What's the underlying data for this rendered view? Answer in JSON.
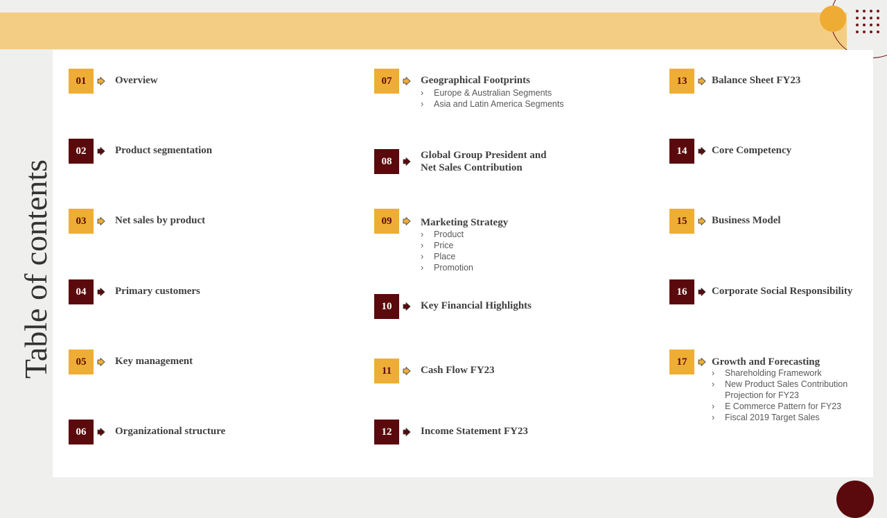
{
  "page": {
    "title": "Table of contents"
  },
  "colors": {
    "gold": "#eeae36",
    "maroon": "#5a0a0c",
    "band": "#f4cd85"
  },
  "items": [
    {
      "number": "01",
      "title": "Overview",
      "style": "gold",
      "subitems": []
    },
    {
      "number": "02",
      "title": "Product segmentation",
      "style": "maroon",
      "subitems": []
    },
    {
      "number": "03",
      "title": "Net sales by product",
      "style": "gold",
      "subitems": []
    },
    {
      "number": "04",
      "title": "Primary customers",
      "style": "maroon",
      "subitems": []
    },
    {
      "number": "05",
      "title": "Key management",
      "style": "gold",
      "subitems": []
    },
    {
      "number": "06",
      "title": "Organizational structure",
      "style": "maroon",
      "subitems": []
    },
    {
      "number": "07",
      "title": "Geographical Footprints",
      "style": "gold",
      "subitems": [
        "Europe & Australian Segments",
        "Asia and Latin America Segments"
      ]
    },
    {
      "number": "08",
      "title_lines": [
        "Global Group President and",
        "Net Sales Contribution"
      ],
      "style": "maroon",
      "subitems": []
    },
    {
      "number": "09",
      "title": "Marketing Strategy",
      "style": "gold",
      "subitems": [
        "Product",
        "Price",
        "Place",
        "Promotion"
      ]
    },
    {
      "number": "10",
      "title": "Key Financial Highlights",
      "style": "maroon",
      "subitems": []
    },
    {
      "number": "11",
      "title": "Cash Flow FY23",
      "style": "gold",
      "subitems": []
    },
    {
      "number": "12",
      "title": "Income Statement FY23",
      "style": "maroon",
      "subitems": []
    },
    {
      "number": "13",
      "title": "Balance Sheet FY23",
      "style": "gold",
      "subitems": []
    },
    {
      "number": "14",
      "title": "Core Competency",
      "style": "maroon",
      "subitems": []
    },
    {
      "number": "15",
      "title": "Business Model",
      "style": "gold",
      "subitems": []
    },
    {
      "number": "16",
      "title": "Corporate Social Responsibility",
      "style": "maroon",
      "subitems": []
    },
    {
      "number": "17",
      "title": "Growth and Forecasting",
      "style": "gold",
      "subitems": [
        "Shareholding Framework",
        "New Product Sales Contribution",
        "Projection for FY23",
        "E Commerce Pattern for FY23",
        "Fiscal 2019 Target Sales"
      ]
    }
  ]
}
